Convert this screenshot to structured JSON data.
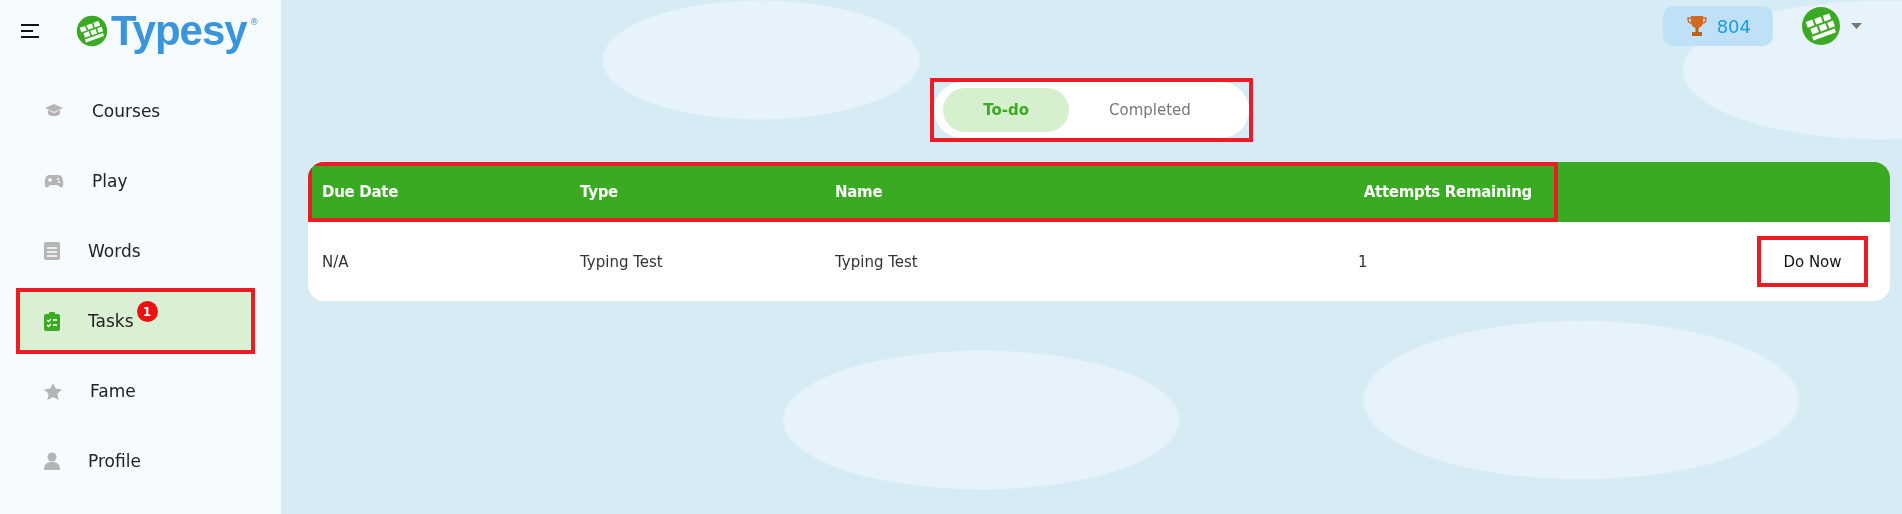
{
  "brand": {
    "name": "Typesy",
    "mark": "®"
  },
  "sidebar": {
    "items": [
      {
        "label": "Courses",
        "selected": false,
        "highlighted": false
      },
      {
        "label": "Play",
        "selected": false,
        "highlighted": false
      },
      {
        "label": "Words",
        "selected": false,
        "highlighted": false
      },
      {
        "label": "Tasks",
        "selected": true,
        "highlighted": true,
        "badge": "1"
      },
      {
        "label": "Fame",
        "selected": false,
        "highlighted": false
      },
      {
        "label": "Profile",
        "selected": false,
        "highlighted": false
      }
    ]
  },
  "topbar": {
    "score": "804"
  },
  "tabs": {
    "highlighted": true,
    "items": [
      {
        "label": "To-do",
        "selected": true
      },
      {
        "label": "Completed",
        "selected": false
      }
    ]
  },
  "table": {
    "header_highlighted": true,
    "columns": [
      "Due Date",
      "Type",
      "Name",
      "Attempts Remaining"
    ],
    "rows": [
      {
        "cells": [
          "N/A",
          "Typing Test",
          "Typing Test",
          "1"
        ],
        "action": {
          "label": "Do Now",
          "highlighted": true
        }
      }
    ]
  }
}
